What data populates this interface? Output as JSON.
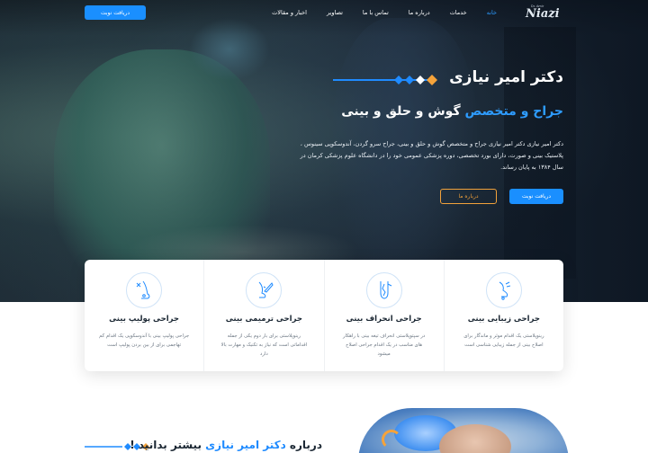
{
  "nav": {
    "appointment_button": "دریافت نوبت",
    "items": [
      {
        "label": "خانه",
        "active": true
      },
      {
        "label": "خدمات",
        "active": false
      },
      {
        "label": "درباره ما",
        "active": false
      },
      {
        "label": "تماس با ما",
        "active": false
      },
      {
        "label": "تصاویر",
        "active": false
      },
      {
        "label": "اخبار و مقالات",
        "active": false
      }
    ],
    "logo_text": "Niazi",
    "logo_sub": "Dr. Amir"
  },
  "hero": {
    "title": "دکتر امیر نیازی",
    "subtitle_prefix": "جراح و متخصص",
    "subtitle_highlight": "جراح و متخصص",
    "subtitle_rest": "گوش و حلق و بینی",
    "description": "دکتر امیر نیازی دکتر امیر نیازی جراح و متخصص گوش و حلق و بینی، جراح سرو گردن، آندوسکوپی سینوس ، پلاستیک بینی و صورت، دارای بورد تخصصی، دوره پزشکی عمومی خود را در دانشگاه علوم پزشکی کرمان در سال ۱۳۸۴ به پایان رساند.",
    "primary_button": "دریافت نوبت",
    "secondary_button": "درباره ما"
  },
  "services": [
    {
      "title": "جراحی زیبایی بینی",
      "desc": "رینوپلاستی یک اقدام موثر و ماندگار برای اصلاح بینی از جمله زیبایی شناسی است",
      "icon": "nose-profile-icon"
    },
    {
      "title": "جراحی انحراف بینی",
      "desc": "در سپتوپلاستی انحراف تیغه بینی با راهکار های مناسب در یک اقدام جراحی اصلاح میشود",
      "icon": "septum-icon"
    },
    {
      "title": "جراحی ترمیمی بینی",
      "desc": "رینوپلاستی برای بار دوم یکی از جمله اقداماتی است که نیاز به تکنیک و مهارت بالا دارد",
      "icon": "nose-scalpel-icon"
    },
    {
      "title": "جراحی پولیپ بینی",
      "desc": "جراحی پولیپ بینی با آندوسکوپی یک اقدام کم تهاجمی برای از بین بردن پولیپ است",
      "icon": "nose-polyp-icon"
    }
  ],
  "about": {
    "prefix": "درباره",
    "highlight": "دکتر امیر نیازی",
    "suffix": "بیشتر بدانید !"
  },
  "colors": {
    "brand_blue": "#1a8fff",
    "accent_orange": "#f5a33a",
    "text_dark": "#1b2733"
  }
}
